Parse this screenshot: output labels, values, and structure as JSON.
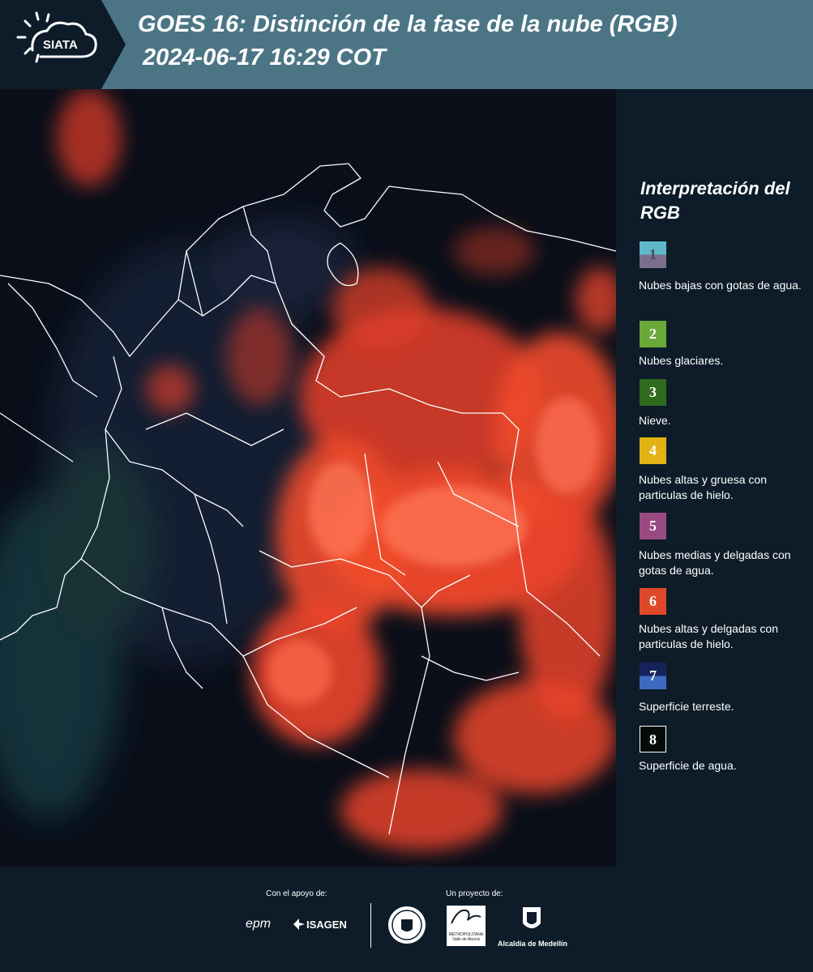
{
  "header": {
    "logo_text": "SIATA",
    "title_line1": "GOES 16: Distinción de la fase de la nube (RGB)",
    "title_line2": "2024-06-17 16:29 COT"
  },
  "legend": {
    "title": "Interpretación del RGB",
    "items": [
      {
        "number": "1",
        "label": "Nubes bajas con gotas de agua.",
        "color_top": "#5fb8c8",
        "color_bottom": "#7a6f8c"
      },
      {
        "number": "2",
        "label": "Nubes glaciares.",
        "color_top": "#6aa83a",
        "color_bottom": "#6aa83a"
      },
      {
        "number": "3",
        "label": "Nieve.",
        "color_top": "#2f6a1e",
        "color_bottom": "#2f6a1e"
      },
      {
        "number": "4",
        "label": "Nubes altas y gruesa con particulas de hielo.",
        "color_top": "#e2b214",
        "color_bottom": "#e2b214"
      },
      {
        "number": "5",
        "label": "Nubes medias y delgadas con gotas de agua.",
        "color_top": "#9a4a82",
        "color_bottom": "#9a4a82"
      },
      {
        "number": "6",
        "label": "Nubes altas y delgadas con particulas de hielo.",
        "color_top": "#e0482a",
        "color_bottom": "#e0482a"
      },
      {
        "number": "7",
        "label": "Superficie terreste.",
        "color_top": "#14245a",
        "color_bottom": "#3d6ac0"
      },
      {
        "number": "8",
        "label": "Superficie de agua.",
        "color_top": "#050a0a",
        "color_bottom": "#050a0a"
      }
    ]
  },
  "footer": {
    "support_caption": "Con el apoyo de:",
    "project_caption": "Un proyecto de:",
    "partners": [
      "epm",
      "ISAGEN",
      "METROPOLITANA Valle de Aburrá",
      "Alcaldía de Medellín"
    ]
  },
  "colors": {
    "header_bg": "#4b7585",
    "panel_bg": "#0d1c28",
    "cloud_red": "#f0452c",
    "border_white": "#ffffff"
  }
}
